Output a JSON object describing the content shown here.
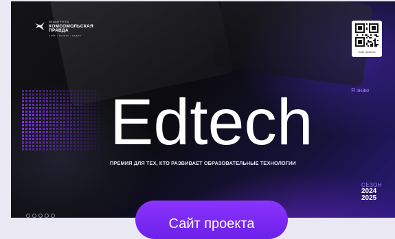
{
  "logo": {
    "small": "МЕДИАГРУППА",
    "line1": "КОМСОМОЛЬСКАЯ",
    "line2": "ПРАВДА",
    "tagline": "САЙТ • ГАЗЕТА • РАДИО"
  },
  "qr": {
    "caption": "Сайт проекта"
  },
  "hero": {
    "kicker": "Я знаю",
    "title": "Edtech",
    "subtitle": "ПРЕМИЯ ДЛЯ ТЕХ, КТО РАЗВИВАЕТ ОБРАЗОВАТЕЛЬНЫЕ ТЕХНОЛОГИИ"
  },
  "season": {
    "label": "СЕЗОН",
    "year1": "2024",
    "year2": "2025"
  },
  "cta": {
    "label": "Сайт проекта"
  },
  "social_icons": [
    "social-icon-1",
    "social-icon-2",
    "social-icon-3",
    "social-icon-4",
    "social-icon-5"
  ],
  "colors": {
    "accent": "#8b34ff",
    "kicker": "#9d82ff",
    "background": "#0c0c10"
  }
}
